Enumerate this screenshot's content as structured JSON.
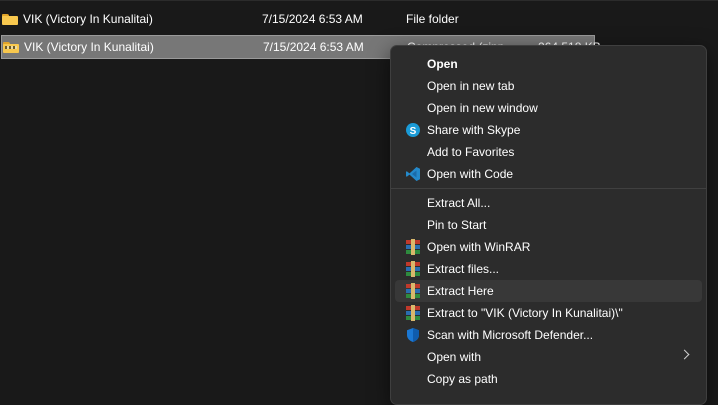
{
  "files": [
    {
      "name": "VIK (Victory In Kunalitai)",
      "date": "7/15/2024 6:53 AM",
      "type": "File folder",
      "size": "",
      "icon": "folder-icon",
      "selected": false
    },
    {
      "name": "VIK (Victory In Kunalitai)",
      "date": "7/15/2024 6:53 AM",
      "type": "Compressed (zipp...",
      "size": "264,518 KB",
      "icon": "zip-folder-icon",
      "selected": true
    }
  ],
  "context_menu": {
    "items": [
      {
        "label": "Open",
        "icon": "",
        "bold": true
      },
      {
        "label": "Open in new tab",
        "icon": ""
      },
      {
        "label": "Open in new window",
        "icon": ""
      },
      {
        "label": "Share with Skype",
        "icon": "skype-icon"
      },
      {
        "label": "Add to Favorites",
        "icon": ""
      },
      {
        "label": "Open with Code",
        "icon": "vscode-icon"
      },
      {
        "label": "Extract All...",
        "icon": ""
      },
      {
        "label": "Pin to Start",
        "icon": ""
      },
      {
        "label": "Open with WinRAR",
        "icon": "winrar-icon"
      },
      {
        "label": "Extract files...",
        "icon": "winrar-icon"
      },
      {
        "label": "Extract Here",
        "icon": "winrar-icon",
        "hover": true
      },
      {
        "label": "Extract to \"VIK (Victory In Kunalitai)\\\"",
        "icon": "winrar-icon"
      },
      {
        "label": "Scan with Microsoft Defender...",
        "icon": "defender-icon"
      },
      {
        "label": "Open with",
        "icon": "",
        "submenu": true
      },
      {
        "label": "Copy as path",
        "icon": ""
      }
    ]
  },
  "colors": {
    "background": "#191919",
    "menu_background": "#2c2c2c",
    "selection": "#777777",
    "hover": "#383838"
  }
}
